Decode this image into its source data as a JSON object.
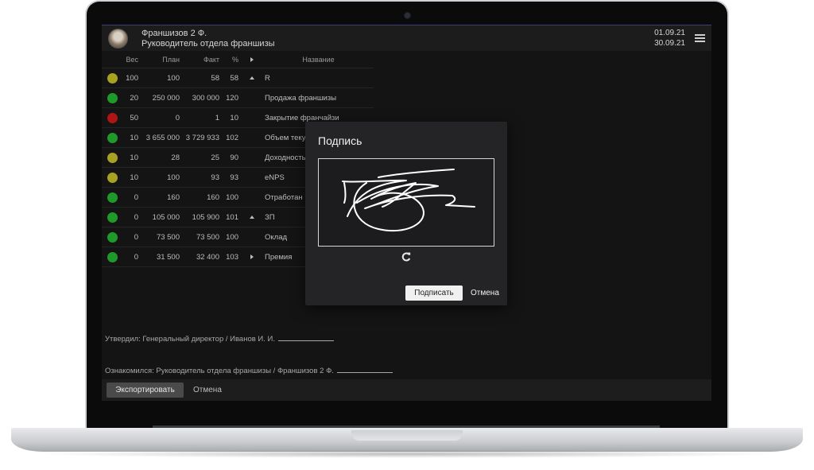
{
  "header": {
    "user_name": "Франшизов 2 Ф.",
    "user_role": "Руководитель отдела франшизы",
    "date_from": "01.09.21",
    "date_to": "30.09.21",
    "menu_icon": "hamburger-menu-icon"
  },
  "table": {
    "columns": {
      "weight": "Вес",
      "plan": "План",
      "fact": "Факт",
      "percent": "%",
      "name": "Название"
    },
    "rows": [
      {
        "status": "#a8a222",
        "weight": "100",
        "plan": "100",
        "fact": "58",
        "percent": "58",
        "arrow": "up",
        "name": "R"
      },
      {
        "status": "#1f9a2a",
        "weight": "20",
        "plan": "250 000",
        "fact": "300 000",
        "percent": "120",
        "arrow": "",
        "name": "Продажа франшизы"
      },
      {
        "status": "#b01515",
        "weight": "50",
        "plan": "0",
        "fact": "1",
        "percent": "10",
        "arrow": "",
        "name": "Закрытие франчайзи"
      },
      {
        "status": "#1f9a2a",
        "weight": "10",
        "plan": "3 655 000",
        "fact": "3 729 933",
        "percent": "102",
        "arrow": "",
        "name": "Объем текущ"
      },
      {
        "status": "#a8a222",
        "weight": "10",
        "plan": "28",
        "fact": "25",
        "percent": "90",
        "arrow": "",
        "name": "Доходность"
      },
      {
        "status": "#a8a222",
        "weight": "10",
        "plan": "100",
        "fact": "93",
        "percent": "93",
        "arrow": "",
        "name": "eNPS"
      },
      {
        "status": "#1f9a2a",
        "weight": "0",
        "plan": "160",
        "fact": "160",
        "percent": "100",
        "arrow": "",
        "name": "Отработан"
      },
      {
        "status": "#1f9a2a",
        "weight": "0",
        "plan": "105 000",
        "fact": "105 900",
        "percent": "101",
        "arrow": "up",
        "name": "ЗП"
      },
      {
        "status": "#1f9a2a",
        "weight": "0",
        "plan": "73 500",
        "fact": "73 500",
        "percent": "100",
        "arrow": "",
        "name": "Оклад"
      },
      {
        "status": "#1f9a2a",
        "weight": "0",
        "plan": "31 500",
        "fact": "32 400",
        "percent": "103",
        "arrow": "right",
        "name": "Премия"
      }
    ]
  },
  "footer": {
    "approved": "Утвердил: Генеральный директор / Иванов И. И.",
    "acquainted": "Ознакомился: Руководитель отдела франшизы / Франшизов 2 Ф.",
    "export_label": "Экспортировать",
    "cancel_label": "Отмена"
  },
  "modal": {
    "title": "Подпись",
    "sign_label": "Подписать",
    "cancel_label": "Отмена",
    "refresh_icon": "refresh-icon"
  }
}
